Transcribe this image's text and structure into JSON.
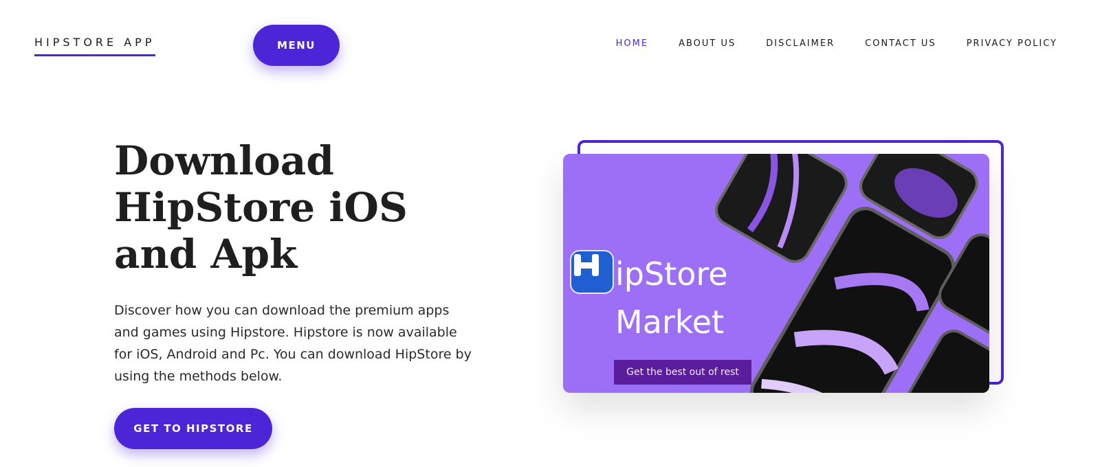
{
  "header": {
    "logo_text": "HIPSTORE APP",
    "menu_label": "MENU",
    "nav": [
      {
        "label": "HOME",
        "active": true
      },
      {
        "label": "ABOUT US",
        "active": false
      },
      {
        "label": "DISCLAIMER",
        "active": false
      },
      {
        "label": "CONTACT US",
        "active": false
      },
      {
        "label": "PRIVACY POLICY",
        "active": false
      }
    ]
  },
  "hero": {
    "title": "Download HipStore iOS and Apk",
    "description": "Discover how you can download the premium apps and games using Hipstore. Hipstore is now available for iOS, Android and Pc. You can download HipStore by using the methods below.",
    "cta_label": "GET TO HIPSTORE"
  },
  "hero_image": {
    "brand_line1": "ipStore",
    "brand_line2": "Market",
    "tagline": "Get the best out of rest",
    "icon_letter": "H"
  },
  "colors": {
    "accent": "#4c25d6",
    "image_bg": "#9d6ff7",
    "tagline_bg": "#5a1e9c",
    "icon_bg": "#1f5fd1"
  }
}
